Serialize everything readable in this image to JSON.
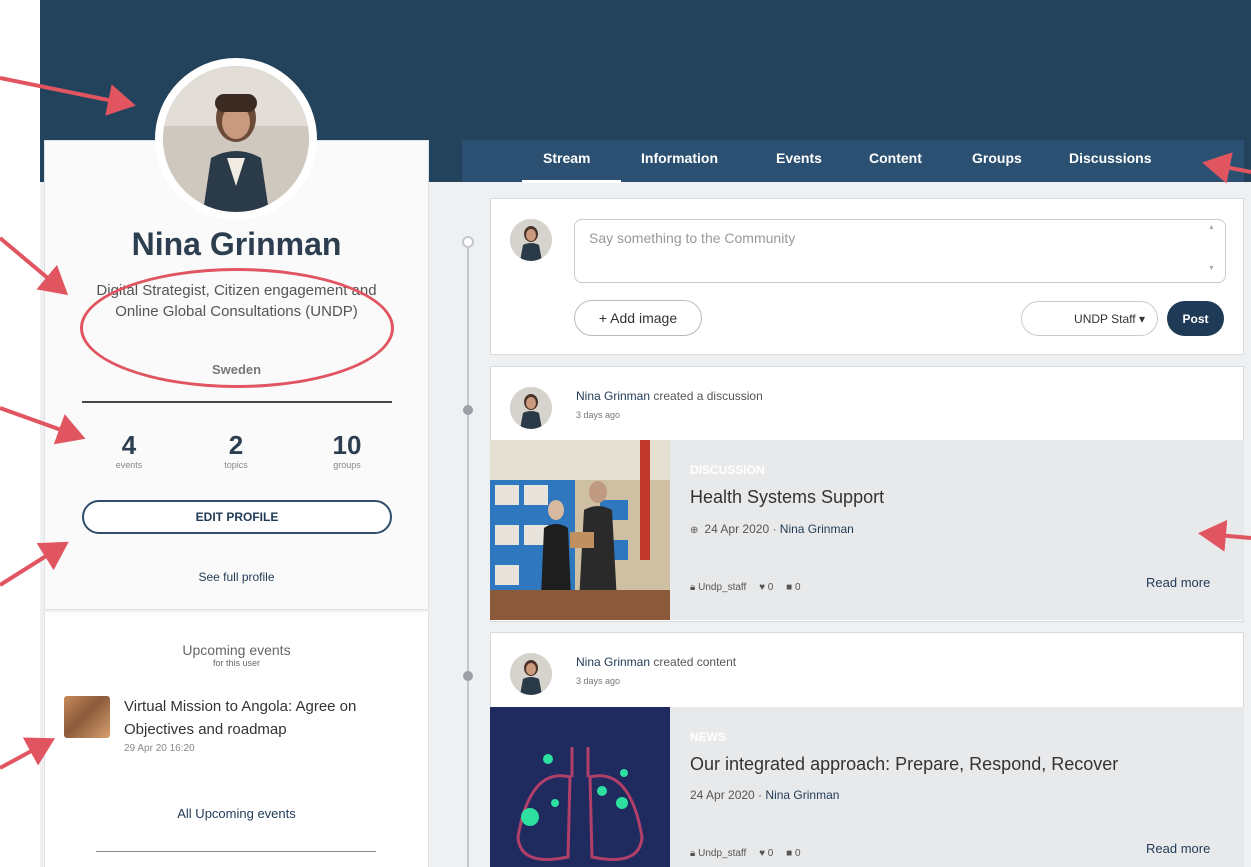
{
  "profile": {
    "name": "Nina Grinman",
    "title": "Digital Strategist, Citizen engagement and Online Global Consultations (UNDP)",
    "country": "Sweden",
    "stats": [
      {
        "value": "4",
        "label": "events"
      },
      {
        "value": "2",
        "label": "topics"
      },
      {
        "value": "10",
        "label": "groups"
      }
    ],
    "edit_label": "EDIT PROFILE",
    "see_full_label": "See full profile"
  },
  "upcoming": {
    "title": "Upcoming events",
    "subtitle": "for this user",
    "event_title": "Virtual Mission to Angola: Agree on Objectives and roadmap",
    "event_date": "29 Apr 20 16:20",
    "all_label": "All Upcoming events"
  },
  "tabs": [
    "Stream",
    "Information",
    "Events",
    "Content",
    "Groups",
    "Discussions"
  ],
  "composer": {
    "placeholder": "Say something to the Community",
    "add_image_label": "+ Add image",
    "privacy_label": "UNDP Staff ▾",
    "post_label": "Post"
  },
  "feed": [
    {
      "author": "Nina Grinman",
      "action": "created a discussion",
      "time": "3 days ago",
      "kind": "DISCUSSION",
      "title": "Health Systems Support",
      "date": "24 Apr 2020 ·",
      "date_author": "Nina Grinman",
      "group": "Undp_staff",
      "likes": "0",
      "comments": "0",
      "read_more": "Read more"
    },
    {
      "author": "Nina Grinman",
      "action": "created content",
      "time": "3 days ago",
      "kind": "NEWS",
      "title": "Our integrated approach: Prepare, Respond, Recover",
      "date": "24 Apr 2020 ·",
      "date_author": "Nina Grinman",
      "group": "Undp_staff",
      "likes": "0",
      "comments": "0",
      "read_more": "Read more"
    }
  ],
  "colors": {
    "banner": "#23435c",
    "tabs_bar": "#2b5072",
    "accent": "#1f3a56",
    "annotation": "#e05560"
  }
}
